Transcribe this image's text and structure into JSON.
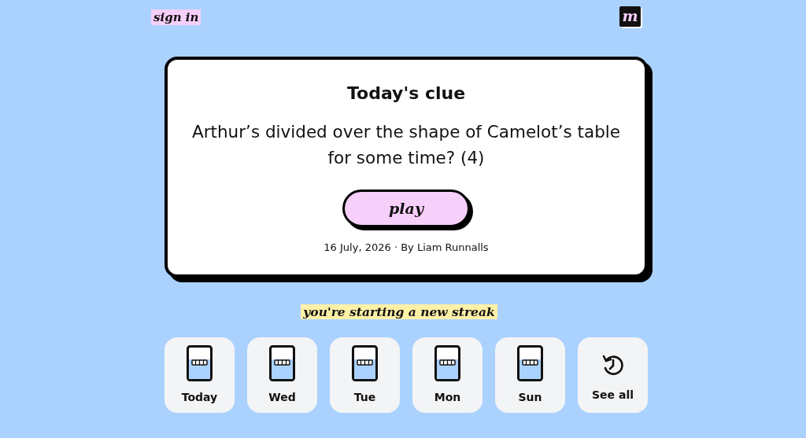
{
  "header": {
    "sign_in": "sign in",
    "logo": "m"
  },
  "clue_card": {
    "title": "Today's clue",
    "clue": "Arthur’s divided over the shape of Camelot’s table for some time? (4)",
    "play_button": "play",
    "byline": "16 July, 2026 · By Liam Runnalls"
  },
  "streak_message": "you're starting a new streak",
  "days": [
    {
      "kind": "puzzle",
      "label": "Today"
    },
    {
      "kind": "puzzle",
      "label": "Wed"
    },
    {
      "kind": "puzzle",
      "label": "Tue"
    },
    {
      "kind": "puzzle",
      "label": "Mon"
    },
    {
      "kind": "puzzle",
      "label": "Sun"
    },
    {
      "kind": "history",
      "label": "See all"
    }
  ]
}
